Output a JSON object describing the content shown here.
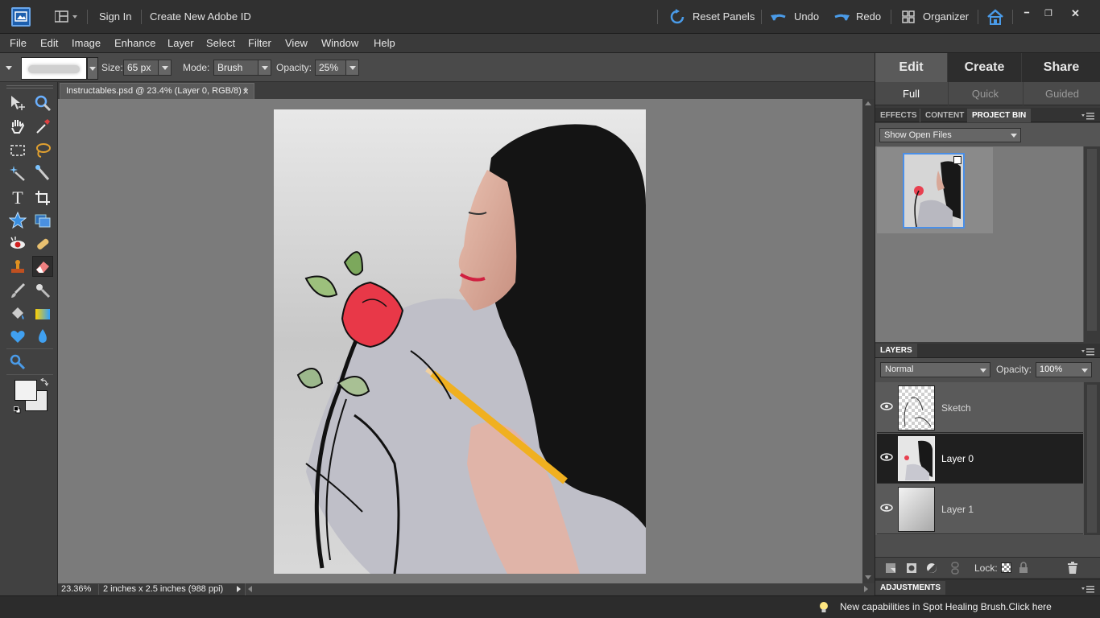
{
  "titlebar": {
    "sign_in": "Sign In",
    "create_adobe_id": "Create New Adobe ID",
    "reset_panels": "Reset Panels",
    "undo": "Undo",
    "redo": "Redo",
    "organizer": "Organizer",
    "minimize_glyph": "━",
    "maximize_glyph": "❐",
    "close_glyph": "✕"
  },
  "menu": [
    "File",
    "Edit",
    "Image",
    "Enhance",
    "Layer",
    "Select",
    "Filter",
    "View",
    "Window",
    "Help"
  ],
  "options": {
    "size_label": "Size:",
    "size_value": "65 px",
    "mode_label": "Mode:",
    "mode_value": "Brush",
    "opacity_label": "Opacity:",
    "opacity_value": "25%"
  },
  "document": {
    "tab_title": "Instructables.psd @ 23.4% (Layer 0, RGB/8) *",
    "tab_close": "×"
  },
  "status": {
    "zoom": "23.36%",
    "doc_size": "2 inches x 2.5 inches (988 ppi)"
  },
  "notification": "New capabilities in Spot Healing Brush.Click here",
  "panel": {
    "mode_tabs": [
      "Edit",
      "Create",
      "Share"
    ],
    "sub_tabs": [
      "Full",
      "Quick",
      "Guided"
    ],
    "bin_tabs": [
      "EFFECTS",
      "CONTENT",
      "PROJECT BIN"
    ],
    "bin_dropdown": "Show Open Files",
    "layers_title": "LAYERS",
    "blend_mode": "Normal",
    "opacity_label": "Opacity:",
    "opacity_value": "100%",
    "layers": [
      "Sketch",
      "Layer 0",
      "Layer 1"
    ],
    "lock_label": "Lock:",
    "adjustments_title": "ADJUSTMENTS"
  },
  "colors": {
    "accent_blue": "#3a7bd5",
    "selected_layer": "#1f1f1f",
    "canvas_bg": "#7b7b7b"
  }
}
